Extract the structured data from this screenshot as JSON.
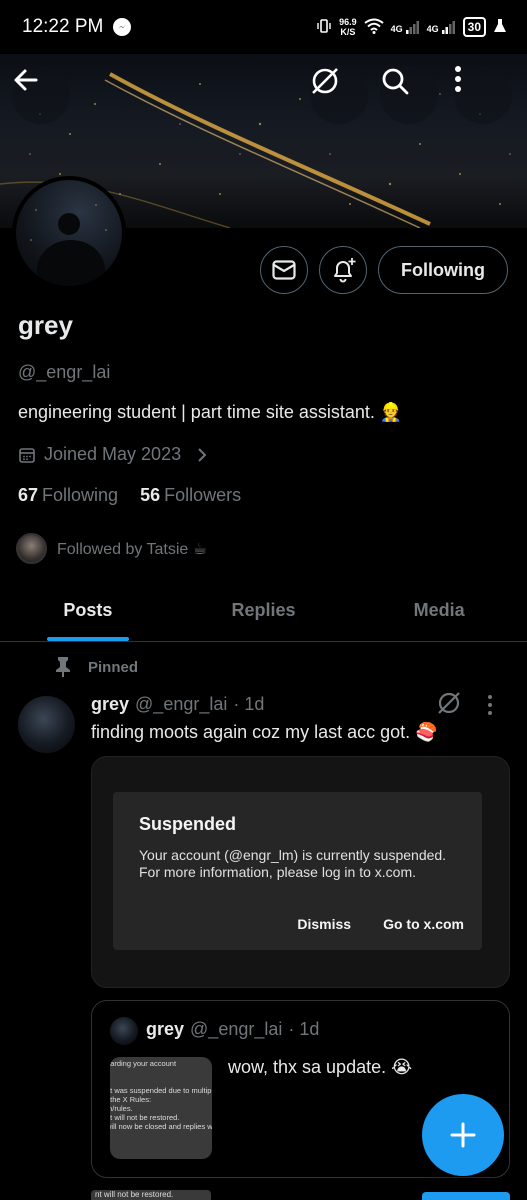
{
  "status_bar": {
    "time": "12:22 PM",
    "net_speed_value": "96.9",
    "net_speed_unit": "K/S",
    "signal_1": "4G",
    "signal_2": "4G",
    "battery": "30"
  },
  "profile": {
    "name": "grey",
    "handle": "@_engr_lai",
    "bio": "engineering student | part time site assistant. 👷",
    "joined": "Joined May 2023",
    "following_count": "67",
    "following_label": "Following",
    "followers_count": "56",
    "followers_label": "Followers",
    "followed_by": "Followed by Tatsie ☕",
    "follow_button": "Following"
  },
  "tabs": [
    {
      "label": "Posts",
      "active": true
    },
    {
      "label": "Replies",
      "active": false
    },
    {
      "label": "Media",
      "active": false
    }
  ],
  "post": {
    "pinned_label": "Pinned",
    "author": "grey",
    "handle": "@_engr_lai",
    "time": "· 1d",
    "text": "finding moots again coz my last acc got. 🍣",
    "dialog": {
      "title": "Suspended",
      "body_line1": "Your account (@engr_lm) is currently suspended.",
      "body_line2": "For more information, please log in to x.com.",
      "dismiss": "Dismiss",
      "goto": "Go to x.com"
    },
    "quote": {
      "author": "grey",
      "handle": "@_engr_lai",
      "time": "· 1d",
      "text": "wow, thx sa update. 😭",
      "thumb_lines": [
        "garding your account",
        "",
        "",
        "nt was suspended due to multip",
        "f the X Rules:",
        "m/rules.",
        "nt will not be restored.",
        "will now be closed and replies wil"
      ]
    },
    "next_peek": "nt will not be restored."
  },
  "colors": {
    "accent": "#1d9bf0",
    "background": "#000000",
    "muted_text": "#71767b",
    "primary_text": "#e7e9ea"
  },
  "icons": {
    "back": "arrow-left-icon",
    "grok": "grok-icon",
    "search": "search-icon",
    "more": "more-vertical-icon",
    "message": "envelope-icon",
    "notify": "bell-plus-icon",
    "calendar": "calendar-icon",
    "pin": "pin-icon",
    "compose": "plus-icon"
  }
}
